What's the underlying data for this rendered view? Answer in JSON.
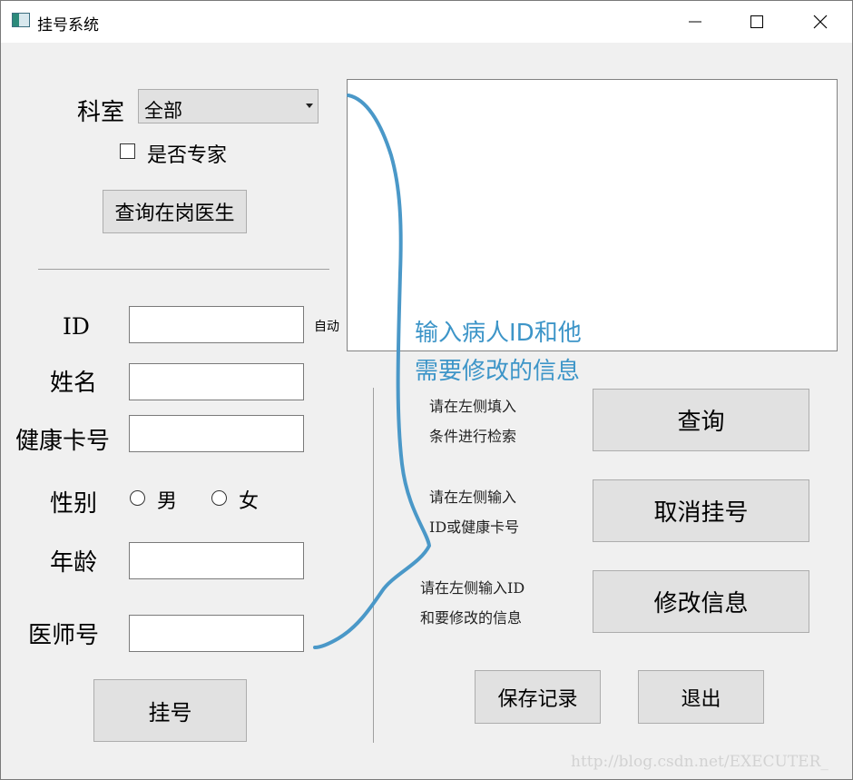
{
  "window": {
    "title": "挂号系统",
    "icon": "app-window-icon",
    "controls": [
      "minimize-icon",
      "maximize-icon",
      "close-icon"
    ]
  },
  "left_panel": {
    "department_label": "科室",
    "department_value": "全部",
    "expert_checkbox_label": "是否专家",
    "expert_checked": false,
    "query_doctors_button": "查询在岗医生",
    "id_label": "ID",
    "id_value": "",
    "id_auto_note": "自动",
    "name_label": "姓名",
    "name_value": "",
    "health_card_label": "健康卡号",
    "health_card_value": "",
    "gender_label": "性别",
    "gender_male": "男",
    "gender_female": "女",
    "gender_selected": "",
    "age_label": "年龄",
    "age_value": "",
    "doctor_no_label": "医师号",
    "doctor_no_value": "",
    "register_button": "挂号"
  },
  "right_panel": {
    "output_text": "",
    "query_hint_1": "请在左侧填入",
    "query_hint_2": "条件进行检索",
    "query_button": "查询",
    "cancel_hint_1": "请在左侧输入",
    "cancel_hint_2": "ID或健康卡号",
    "cancel_button": "取消挂号",
    "modify_hint_1": "请在左侧输入ID",
    "modify_hint_2": "和要修改的信息",
    "modify_button": "修改信息",
    "save_button": "保存记录",
    "exit_button": "退出"
  },
  "annotation": {
    "line1": "输入病人ID和他",
    "line2": "需要修改的信息",
    "color": "#3d95c8"
  },
  "watermark": "http://blog.csdn.net/EXECUTER_"
}
